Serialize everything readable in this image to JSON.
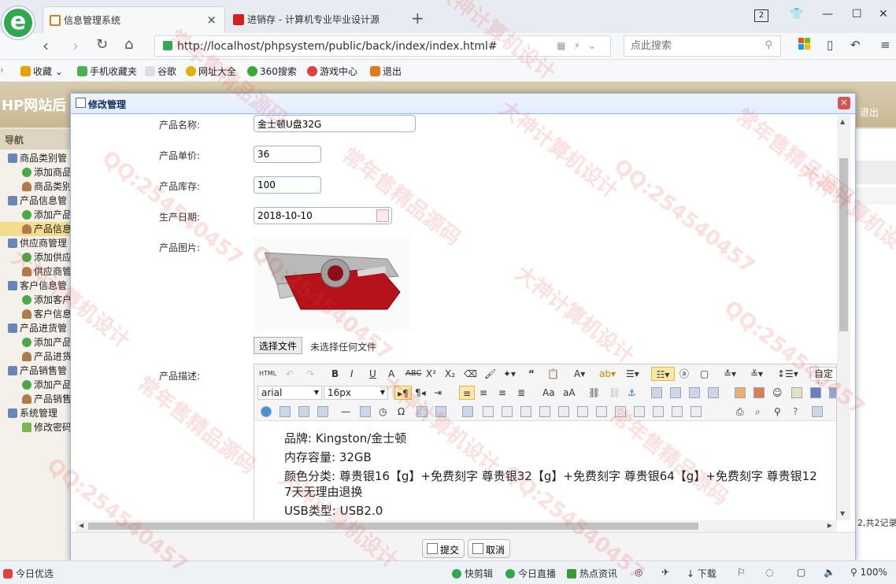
{
  "browser": {
    "logo": "e",
    "tabs": [
      {
        "title": "信息管理系统",
        "close": "×"
      },
      {
        "title": "进销存 - 计算机专业毕业设计源"
      }
    ],
    "new_tab": "+",
    "tab_count": "2",
    "window_controls": {
      "minimize": "—",
      "maximize": "☐",
      "close": "✕"
    },
    "address": "http://localhost/phpsystem/public/back/index/index.html#",
    "search_placeholder": "点此搜索",
    "bookmarks": [
      {
        "label": "收藏",
        "icon": "star-icon",
        "color": "#e8a000"
      },
      {
        "label": "手机收藏夹",
        "icon": "phone-icon",
        "color": "#4caf50"
      },
      {
        "label": "谷歌",
        "icon": "page-icon",
        "color": "#bbbbbb"
      },
      {
        "label": "网址大全",
        "icon": "plus-circle-icon",
        "color": "#e3b000"
      },
      {
        "label": "360搜索",
        "icon": "search-360-icon",
        "color": "#3aa832"
      },
      {
        "label": "游戏中心",
        "icon": "game-icon",
        "color": "#e04040"
      },
      {
        "label": "退出",
        "icon": "exit-icon",
        "color": "#e07a1f"
      }
    ]
  },
  "admin": {
    "title": "HP网站后",
    "logout": "退出",
    "nav_title": "导航",
    "tree": [
      {
        "label": "商品类别管",
        "kind": "group"
      },
      {
        "label": "添加商品",
        "kind": "add"
      },
      {
        "label": "商品类别",
        "kind": "person"
      },
      {
        "label": "产品信息管",
        "kind": "group"
      },
      {
        "label": "添加产品",
        "kind": "add"
      },
      {
        "label": "产品信息",
        "kind": "person",
        "selected": true
      },
      {
        "label": "供应商管理",
        "kind": "group"
      },
      {
        "label": "添加供应",
        "kind": "add"
      },
      {
        "label": "供应商管",
        "kind": "person"
      },
      {
        "label": "客户信息管",
        "kind": "group"
      },
      {
        "label": "添加客户",
        "kind": "add"
      },
      {
        "label": "客户信息",
        "kind": "person"
      },
      {
        "label": "产品进货管",
        "kind": "group"
      },
      {
        "label": "添加产品",
        "kind": "add"
      },
      {
        "label": "产品进货",
        "kind": "person"
      },
      {
        "label": "产品销售管",
        "kind": "group"
      },
      {
        "label": "添加产品",
        "kind": "add"
      },
      {
        "label": "产品销售",
        "kind": "person"
      },
      {
        "label": "系统管理",
        "kind": "group"
      },
      {
        "label": "修改密码",
        "kind": "pencil"
      }
    ],
    "page_total": "2,共2记录"
  },
  "modal": {
    "title": "修改管理",
    "close": "×",
    "fields": {
      "name_label": "产品名称:",
      "name_value": "金士顿U盘32G",
      "price_label": "产品单价:",
      "price_value": "36",
      "stock_label": "产品库存:",
      "stock_value": "100",
      "date_label": "生产日期:",
      "date_value": "2018-10-10",
      "image_label": "产品图片:",
      "file_button": "选择文件",
      "file_status": "未选择任何文件",
      "desc_label": "产品描述:"
    },
    "editor": {
      "html_btn": "HTML",
      "font_family": "arial",
      "font_size": "16px",
      "custom_title": "自定义",
      "lines": [
        "品牌: Kingston/金士顿",
        "内存容量: 32GB",
        "颜色分类: 尊贵银16【g】+免费刻字 尊贵银32【g】+免费刻字 尊贵银64【g】+免费刻字 尊贵银12",
        "7天无理由退换",
        "USB类型: USB2.0"
      ]
    },
    "submit": "提交",
    "cancel": "取消"
  },
  "status": {
    "left": "今日优选",
    "items": [
      "快剪辑",
      "今日直播",
      "热点资讯",
      "下载"
    ],
    "zoom": "100%"
  },
  "watermark": [
    "QQ:254540457",
    "大神计算机设计",
    "常年售精品源码"
  ]
}
